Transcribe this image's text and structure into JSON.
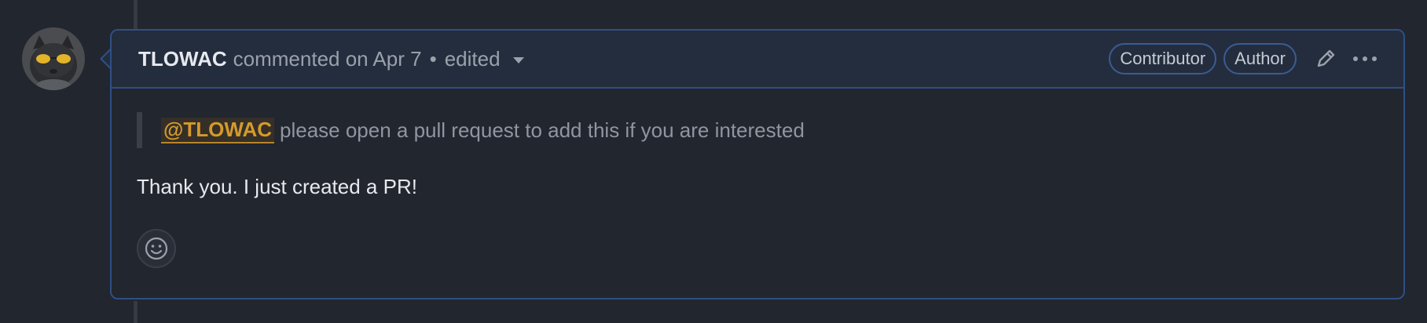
{
  "comment": {
    "author": "TLOWAC",
    "action": "commented on Apr 7",
    "separator": "•",
    "edited_label": "edited",
    "badges": [
      "Contributor",
      "Author"
    ],
    "quote": {
      "mention": "@TLOWAC",
      "text": "please open a pull request to add this if you are interested"
    },
    "reply": "Thank you. I just created a PR!",
    "icons": {
      "edit": "pencil-icon",
      "more": "kebab-horizontal-icon",
      "reaction": "smiley-icon",
      "edited_dropdown": "triangle-down-icon"
    }
  },
  "colors": {
    "background": "#22262e",
    "header_background": "#242d3d",
    "border_accent": "#2f4f86",
    "mention": "#d49a2c"
  }
}
